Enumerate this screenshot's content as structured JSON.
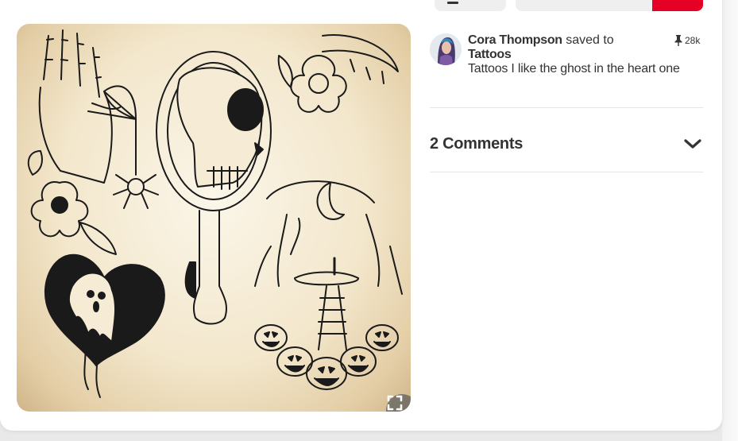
{
  "header": {
    "more_icon": "menu-bars-icon",
    "board_select_placeholder": "",
    "save_label": ""
  },
  "pin": {
    "image_alt": "",
    "expand_icon": "expand-icon"
  },
  "saved_by": {
    "author": "Cora Thompson",
    "action": "saved to",
    "board": "Tattoos",
    "description": "Tattoos I like the ghost in the heart one",
    "repin_count": "28k",
    "repin_icon": "pushpin-icon"
  },
  "comments": {
    "title": "2 Comments",
    "toggle_icon": "chevron-down-icon"
  },
  "colors": {
    "save_red": "#e60023",
    "button_gray": "#efefef",
    "text": "#333333",
    "divider": "#e6e6e6"
  }
}
